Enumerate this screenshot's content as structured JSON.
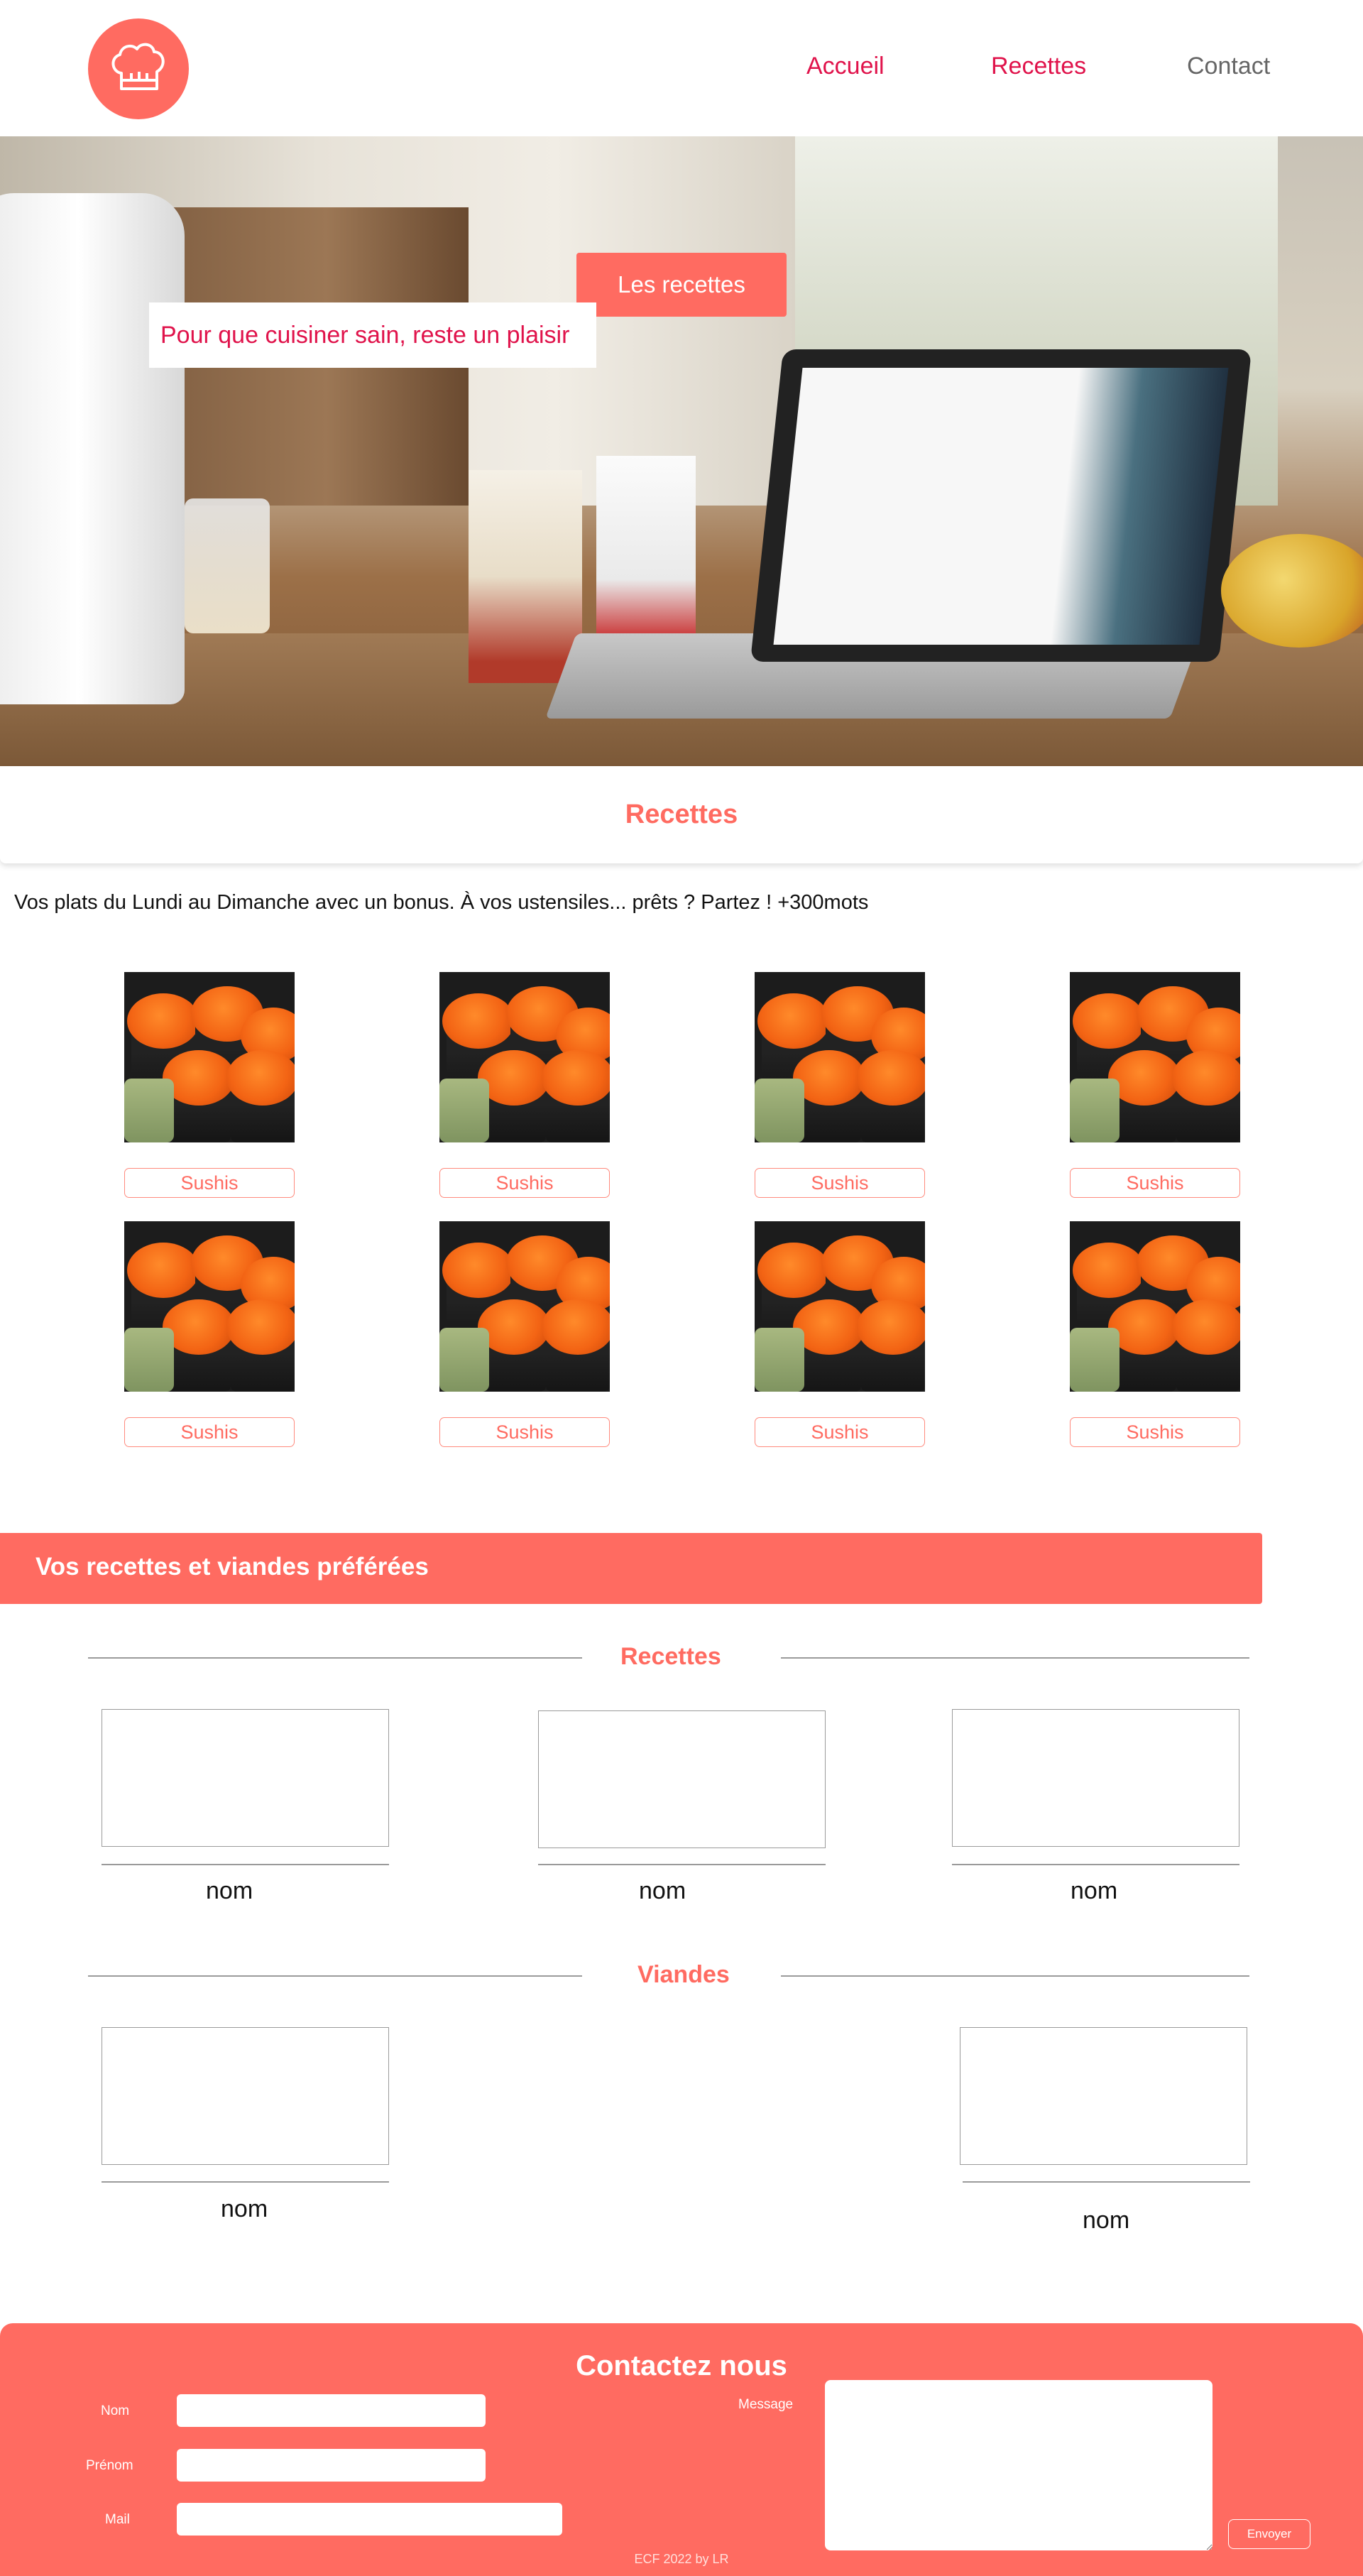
{
  "nav": {
    "accueil": "Accueil",
    "recettes": "Recettes",
    "contact": "Contact"
  },
  "hero": {
    "button": "Les recettes",
    "tagline": "Pour que cuisiner sain, reste un plaisir"
  },
  "recettes_section": {
    "title": "Recettes",
    "intro": "Vos plats du Lundi au Dimanche avec un bonus. À vos ustensiles... prêts ? Partez ! +300mots"
  },
  "recipe_cards": [
    {
      "label": "Sushis"
    },
    {
      "label": "Sushis"
    },
    {
      "label": "Sushis"
    },
    {
      "label": "Sushis"
    },
    {
      "label": "Sushis"
    },
    {
      "label": "Sushis"
    },
    {
      "label": "Sushis"
    },
    {
      "label": "Sushis"
    }
  ],
  "favorites": {
    "title": "Vos recettes et viandes préférées",
    "recettes_title": "Recettes",
    "recettes_items": [
      {
        "name": "nom"
      },
      {
        "name": "nom"
      },
      {
        "name": "nom"
      }
    ],
    "viandes_title": "Viandes",
    "viandes_items": [
      {
        "name": "nom"
      },
      {
        "name": "nom"
      }
    ]
  },
  "contact": {
    "title": "Contactez nous",
    "nom_label": "Nom",
    "prenom_label": "Prénom",
    "mail_label": "Mail",
    "message_label": "Message",
    "send_label": "Envoyer",
    "footer": "ECF 2022 by LR"
  },
  "colors": {
    "accent": "#ff6b61",
    "nav_active": "#e0134b",
    "nav_inactive": "#666666"
  },
  "icons": {
    "logo": "chef-hat-icon"
  }
}
